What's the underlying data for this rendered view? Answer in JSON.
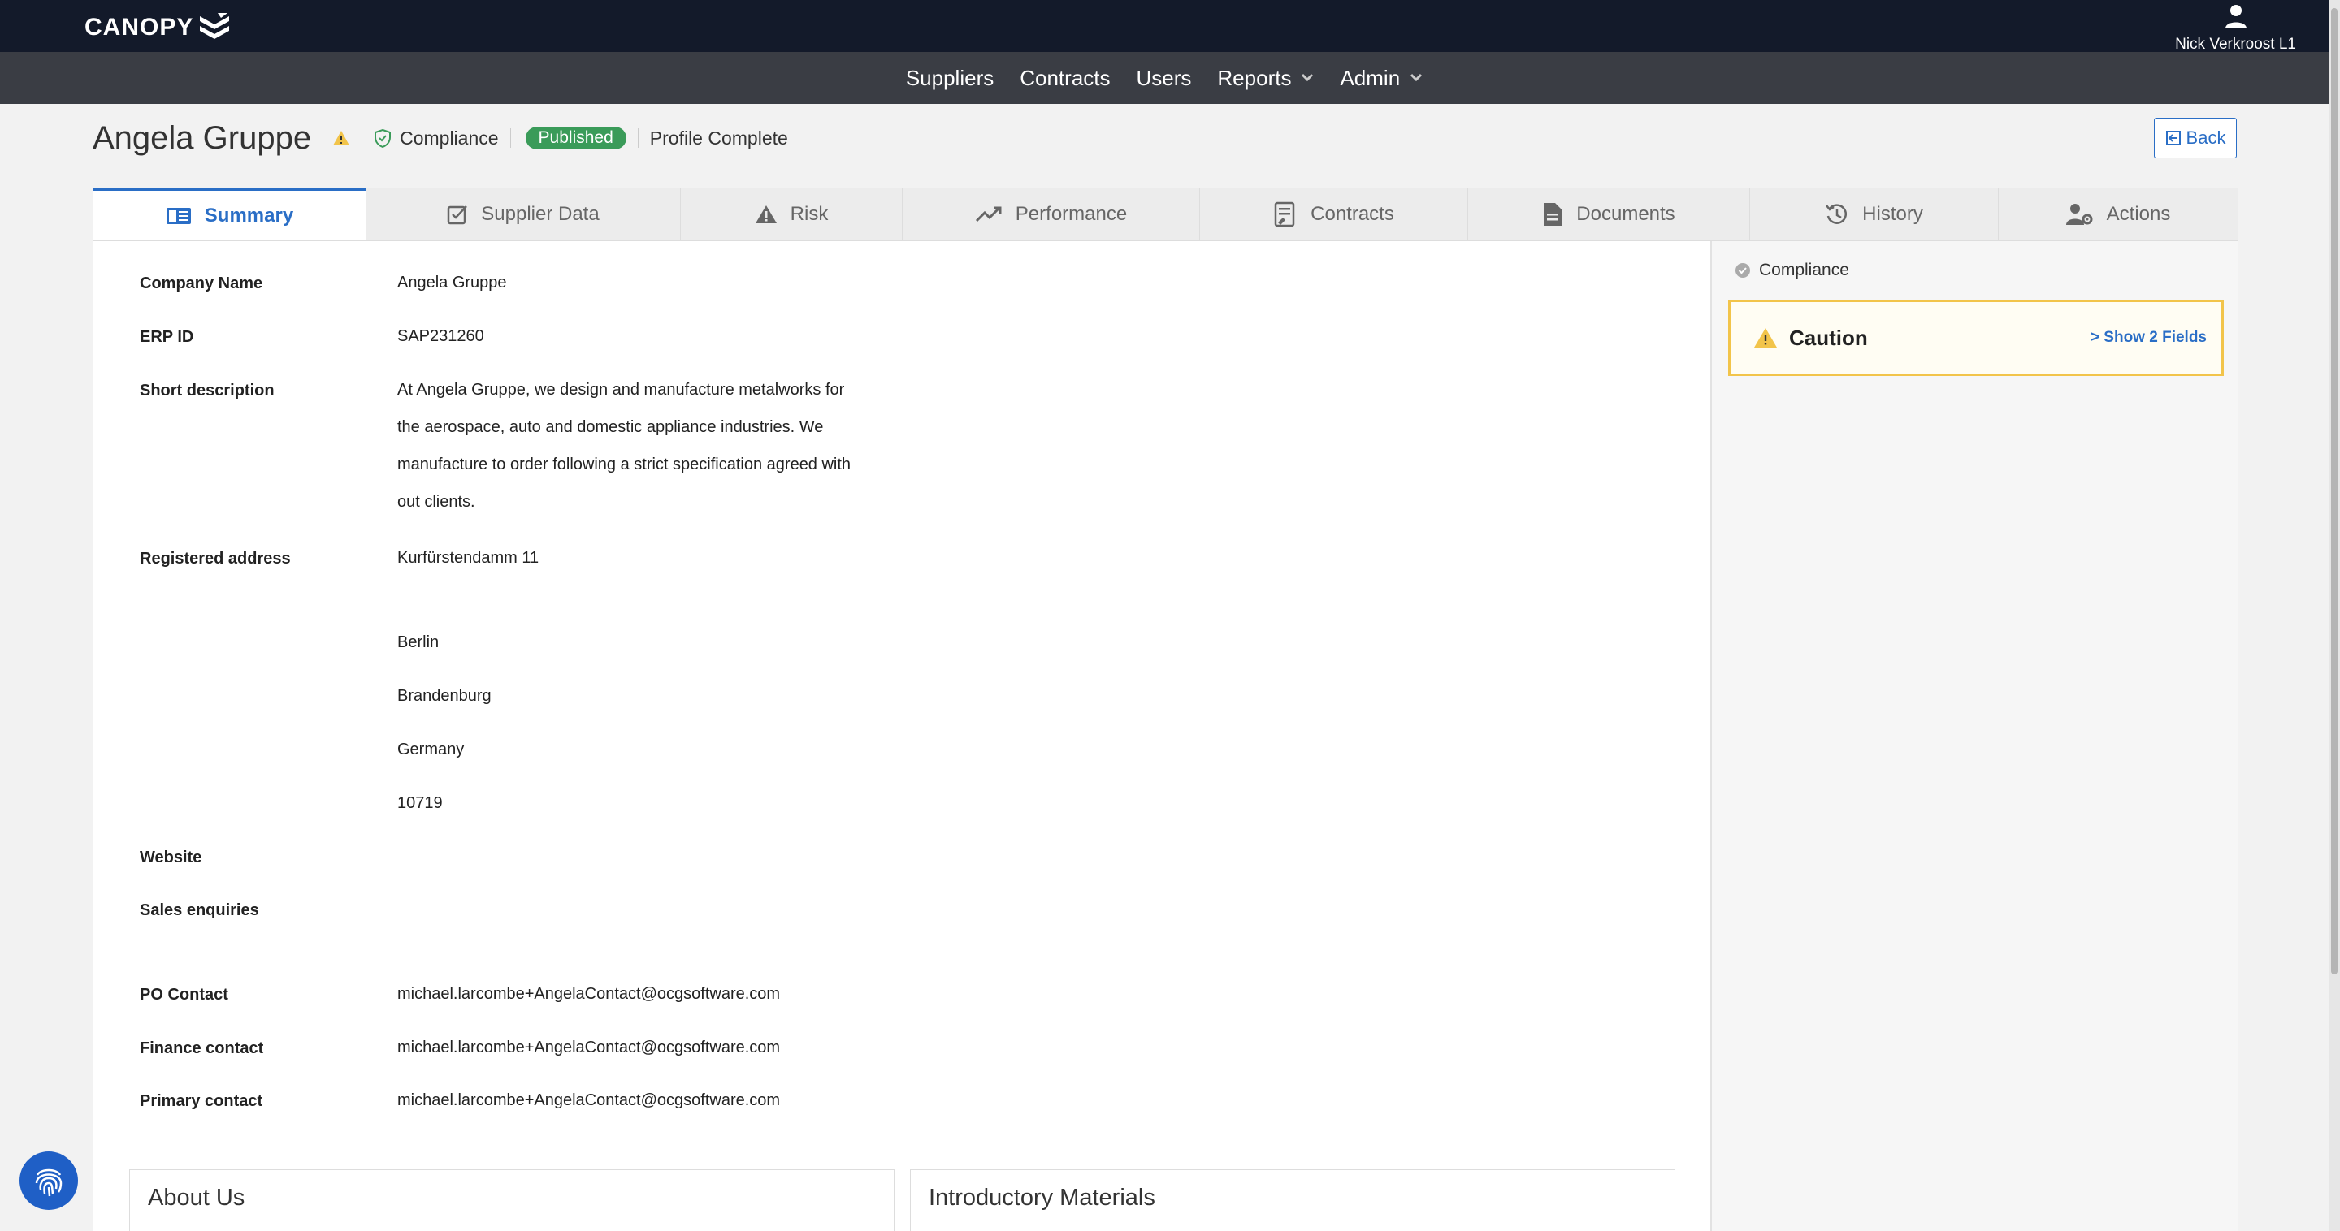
{
  "app": {
    "logo_text": "CANOPY",
    "user_name": "Nick Verkroost L1"
  },
  "nav": {
    "suppliers": "Suppliers",
    "contracts": "Contracts",
    "users": "Users",
    "reports": "Reports",
    "admin": "Admin"
  },
  "header": {
    "company_name": "Angela Gruppe",
    "compliance": "Compliance",
    "status": "Published",
    "profile_status": "Profile Complete",
    "back": "Back"
  },
  "tabs": {
    "summary": "Summary",
    "supplier_data": "Supplier Data",
    "risk": "Risk",
    "performance": "Performance",
    "contracts": "Contracts",
    "documents": "Documents",
    "history": "History",
    "actions": "Actions"
  },
  "fields": {
    "company_name_label": "Company Name",
    "company_name_value": "Angela Gruppe",
    "erp_label": "ERP ID",
    "erp_value": "SAP231260",
    "desc_label": "Short description",
    "desc_line1": "At Angela Gruppe, we design and manufacture metalworks for",
    "desc_line2": "the aerospace, auto and domestic appliance industries. We",
    "desc_line3": "manufacture to order following a strict specification agreed with",
    "desc_line4": "out clients.",
    "address_label": "Registered address",
    "address_street": "Kurfürstendamm 11",
    "address_city": "Berlin",
    "address_region": "Brandenburg",
    "address_country": "Germany",
    "address_postcode": "10719",
    "website_label": "Website",
    "sales_label": "Sales enquiries",
    "po_label": "PO Contact",
    "po_value": "michael.larcombe+AngelaContact@ocgsoftware.com",
    "finance_label": "Finance contact",
    "finance_value": "michael.larcombe+AngelaContact@ocgsoftware.com",
    "primary_label": "Primary contact",
    "primary_value": "michael.larcombe+AngelaContact@ocgsoftware.com"
  },
  "right_panel": {
    "compliance": "Compliance",
    "caution": "Caution",
    "show_fields": "> Show 2 Fields"
  },
  "panels": {
    "about_us": "About Us",
    "intro_materials": "Introductory Materials"
  },
  "colors": {
    "topbar": "#131a2a",
    "navbar": "#3a3d44",
    "accent": "#2a6ec6",
    "published": "#3a9b59",
    "caution_border": "#f2c44a"
  }
}
